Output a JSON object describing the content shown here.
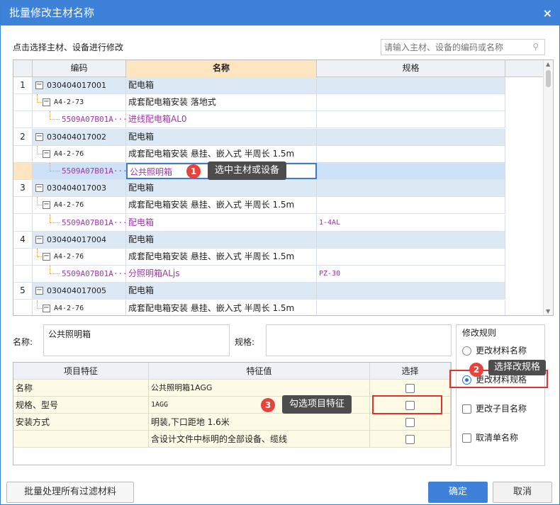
{
  "window": {
    "title": "批量修改主材名称",
    "close": "×"
  },
  "toolbar": {
    "hint": "点击选择主材、设备进行修改",
    "search_placeholder": "请输入主材、设备的编码或名称"
  },
  "grid": {
    "headers": [
      "编码",
      "名称",
      "规格"
    ],
    "rows": [
      {
        "idx": "1",
        "code": "030404017001",
        "name": "配电箱",
        "spec": "",
        "level": 1
      },
      {
        "idx": "",
        "code": "A4-2-73",
        "name": "成套配电箱安装 落地式",
        "spec": "",
        "level": 2
      },
      {
        "idx": "",
        "code": "5509A07B01A···",
        "name": "进线配电箱AL0",
        "spec": "",
        "level": 3
      },
      {
        "idx": "2",
        "code": "030404017002",
        "name": "配电箱",
        "spec": "",
        "level": 1
      },
      {
        "idx": "",
        "code": "A4-2-76",
        "name": "成套配电箱安装 悬挂、嵌入式 半周长 1.5m",
        "spec": "",
        "level": 2
      },
      {
        "idx": "",
        "code": "5509A07B01A···",
        "name": "公共照明箱",
        "spec": "",
        "level": 3,
        "selected": true
      },
      {
        "idx": "3",
        "code": "030404017003",
        "name": "配电箱",
        "spec": "",
        "level": 1
      },
      {
        "idx": "",
        "code": "A4-2-76",
        "name": "成套配电箱安装 悬挂、嵌入式 半周长 1.5m",
        "spec": "",
        "level": 2
      },
      {
        "idx": "",
        "code": "5509A07B01A···",
        "name": "配电箱",
        "spec": "1-4AL",
        "level": 3
      },
      {
        "idx": "4",
        "code": "030404017004",
        "name": "配电箱",
        "spec": "",
        "level": 1
      },
      {
        "idx": "",
        "code": "A4-2-76",
        "name": "成套配电箱安装 悬挂、嵌入式 半周长 1.5m",
        "spec": "",
        "level": 2
      },
      {
        "idx": "",
        "code": "5509A07B01A···",
        "name": "分照明箱ALjs",
        "spec": "PZ-30",
        "level": 3
      },
      {
        "idx": "5",
        "code": "030404017005",
        "name": "配电箱",
        "spec": "",
        "level": 1
      },
      {
        "idx": "",
        "code": "A4-2-76",
        "name": "成套配电箱安装 悬挂、嵌入式 半周长 1.5m",
        "spec": "",
        "level": 2
      }
    ]
  },
  "callouts": [
    {
      "num": "1",
      "text": "选中主材或设备"
    },
    {
      "num": "2",
      "text": "选择改规格"
    },
    {
      "num": "3",
      "text": "勾选项目特征"
    }
  ],
  "edit": {
    "name_label": "名称:",
    "name_value": "公共照明箱",
    "spec_label": "规格:",
    "spec_value": ""
  },
  "features": {
    "headers": [
      "项目特征",
      "特征值",
      "选择"
    ],
    "rows": [
      {
        "feature": "名称",
        "value": "公共照明箱1AGG",
        "checked": false
      },
      {
        "feature": "规格、型号",
        "value": "1AGG",
        "checked": false
      },
      {
        "feature": "安装方式",
        "value": "明装,下口距地 1.6米",
        "checked": false
      },
      {
        "feature": "",
        "value": "含设计文件中标明的全部设备、缆线",
        "checked": false
      }
    ]
  },
  "rules": {
    "title": "修改规则",
    "options": [
      {
        "label": "更改材料名称",
        "type": "radio",
        "checked": false
      },
      {
        "label": "更改材料规格",
        "type": "radio",
        "checked": true
      },
      {
        "label": "更改子目名称",
        "type": "checkbox",
        "checked": false
      },
      {
        "label": "取清单名称",
        "type": "checkbox",
        "checked": false
      }
    ]
  },
  "buttons": {
    "batch": "批量处理所有过滤材料",
    "ok": "确定",
    "cancel": "取消"
  },
  "icons": {
    "search": "search-icon",
    "close": "close-icon"
  },
  "colors": {
    "title_bar": "#3d82d8",
    "highlight": "#e0322f",
    "accent": "#2a72d8"
  }
}
